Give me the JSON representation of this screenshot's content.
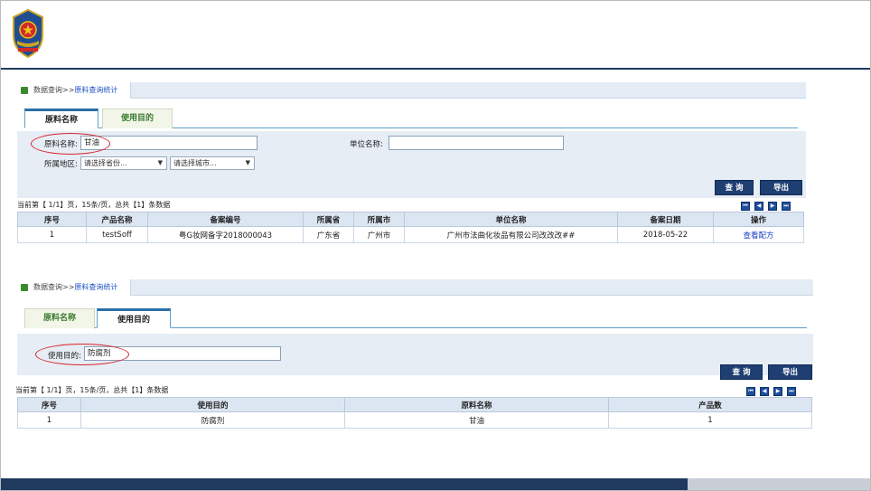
{
  "panel1": {
    "breadcrumb": {
      "root": "数据查询>>",
      "current": "原料查询统计"
    },
    "tabs": [
      "原料名称",
      "使用目的"
    ],
    "fields": {
      "material_label": "原料名称:",
      "material_value": "甘油",
      "unit_label": "单位名称:",
      "unit_value": "",
      "region_label": "所属地区:",
      "province_select": "请选择省份...",
      "city_select": "请选择城市..."
    },
    "buttons": {
      "query": "查 询",
      "export": "导出"
    },
    "page_info": "当前第【 1/1】页，15条/页，总共【1】条数据",
    "table": {
      "headers": [
        "序号",
        "产品名称",
        "备案编号",
        "所属省",
        "所属市",
        "单位名称",
        "备案日期",
        "操作"
      ],
      "rows": [
        [
          "1",
          "testSoff",
          "粤G妆网备字2018000043",
          "广东省",
          "广州市",
          "广州市法曲化妆品有限公司改改改##",
          "2018-05-22",
          "查看配方"
        ]
      ]
    }
  },
  "panel2": {
    "breadcrumb": {
      "root": "数据查询>>",
      "current": "原料查询统计"
    },
    "tabs": [
      "原料名称",
      "使用目的"
    ],
    "fields": {
      "purpose_label": "使用目的:",
      "purpose_value": "防腐剂"
    },
    "buttons": {
      "query": "查 询",
      "export": "导出"
    },
    "page_info": "当前第【 1/1】页，15条/页，总共【1】条数据",
    "table": {
      "headers": [
        "序号",
        "使用目的",
        "原料名称",
        "产品数"
      ],
      "rows": [
        [
          "1",
          "防腐剂",
          "甘油",
          "1"
        ]
      ]
    }
  },
  "pager_icons": [
    "first-page-icon",
    "prev-page-icon",
    "next-page-icon",
    "last-page-icon"
  ],
  "colors": {
    "navy": "#1f3f73",
    "header_line": "#1f3a5e",
    "highlight": "#d9232e",
    "table_header": "#dce6f2"
  }
}
